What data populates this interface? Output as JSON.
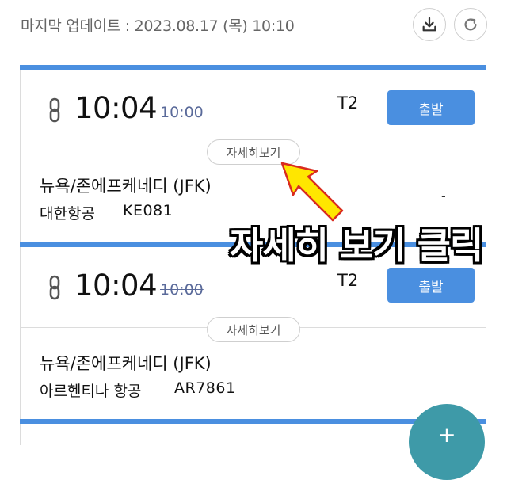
{
  "header": {
    "update_label": "마지막 업데이트 : 2023.08.17 (목) 10:10",
    "download_icon": "download-icon",
    "refresh_icon": "refresh-icon"
  },
  "flights": [
    {
      "time": "10:04",
      "scheduled_time": "10:00",
      "terminal": "T2",
      "status": "출발",
      "detail_label": "자세히보기",
      "destination": "뉴욕/존에프케네디 (JFK)",
      "airline": "대한항공",
      "flight_no": "KE081",
      "extra": "-"
    },
    {
      "time": "10:04",
      "scheduled_time": "10:00",
      "terminal": "T2",
      "status": "출발",
      "detail_label": "자세히보기",
      "destination": "뉴욕/존에프케네디 (JFK)",
      "airline": "아르헨티나 항공",
      "flight_no": "AR7861"
    }
  ],
  "annotation": {
    "text": "자세히 보기 클릭"
  },
  "fab": {
    "icon": "plus-icon",
    "label": "+"
  },
  "colors": {
    "accent": "#4a8fe0",
    "fab": "#3e9aa8",
    "arrow": "#ffe600"
  }
}
